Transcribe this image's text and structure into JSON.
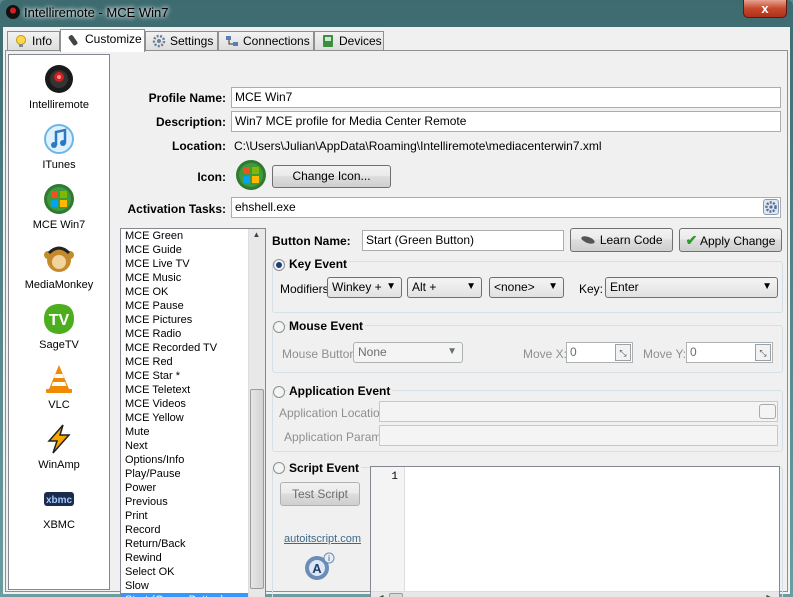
{
  "window": {
    "title": "Intelliremote - MCE Win7",
    "close_glyph": "x"
  },
  "tabs": [
    {
      "label": "Info",
      "icon": "bulb-icon"
    },
    {
      "label": "Customize",
      "icon": "remote-icon"
    },
    {
      "label": "Settings",
      "icon": "gear-icon"
    },
    {
      "label": "Connections",
      "icon": "network-icon"
    },
    {
      "label": "Devices",
      "icon": "device-icon"
    }
  ],
  "profiles": [
    {
      "label": "Intelliremote",
      "icon": "intelliremote-icon"
    },
    {
      "label": "ITunes",
      "icon": "itunes-icon"
    },
    {
      "label": "MCE Win7",
      "icon": "windows-logo-icon"
    },
    {
      "label": "MediaMonkey",
      "icon": "mediamonkey-icon"
    },
    {
      "label": "SageTV",
      "icon": "sagetv-icon"
    },
    {
      "label": "VLC",
      "icon": "vlc-cone-icon"
    },
    {
      "label": "WinAmp",
      "icon": "winamp-bolt-icon"
    },
    {
      "label": "XBMC",
      "icon": "xbmc-icon"
    }
  ],
  "profile_form": {
    "name_label": "Profile Name:",
    "name_value": "MCE Win7",
    "description_label": "Description:",
    "description_value": "Win7 MCE profile for Media Center Remote",
    "location_label": "Location:",
    "location_value": "C:\\Users\\Julian\\AppData\\Roaming\\Intelliremote\\mediacenterwin7.xml",
    "icon_label": "Icon:",
    "change_icon_button": "Change Icon...",
    "activation_label": "Activation Tasks:",
    "activation_value": "ehshell.exe"
  },
  "button_list": {
    "items": [
      "MCE Green",
      "MCE Guide",
      "MCE Live TV",
      "MCE Music",
      "MCE OK",
      "MCE Pause",
      "MCE Pictures",
      "MCE Radio",
      "MCE Recorded TV",
      "MCE Red",
      "MCE Star *",
      "MCE Teletext",
      "MCE Videos",
      "MCE Yellow",
      "Mute",
      "Next",
      "Options/Info",
      "Play/Pause",
      "Power",
      "Previous",
      "Print",
      "Record",
      "Return/Back",
      "Rewind",
      "Select OK",
      "Slow",
      "Start (Green Button)"
    ],
    "selected": "Start (Green Button)"
  },
  "button_editor": {
    "name_label": "Button Name:",
    "name_value": "Start (Green Button)",
    "learn_code_button": "Learn Code",
    "apply_change_button": "Apply Change"
  },
  "key_event": {
    "title": "Key Event",
    "selected": true,
    "modifiers_label": "Modifiers:",
    "modifier1": "Winkey +",
    "modifier2": "Alt +",
    "modifier3": "<none>",
    "key_label": "Key:",
    "key_value": "Enter"
  },
  "mouse_event": {
    "title": "Mouse Event",
    "button_label": "Mouse Button:",
    "button_value": "None",
    "move_x_label": "Move X:",
    "move_x_value": "0",
    "move_y_label": "Move Y:",
    "move_y_value": "0"
  },
  "app_event": {
    "title": "Application Event",
    "location_label": "Application Location:",
    "params_label": "Application Params:"
  },
  "script_event": {
    "title": "Script Event",
    "test_button": "Test Script",
    "link": "autoitscript.com",
    "line_number": "1"
  }
}
